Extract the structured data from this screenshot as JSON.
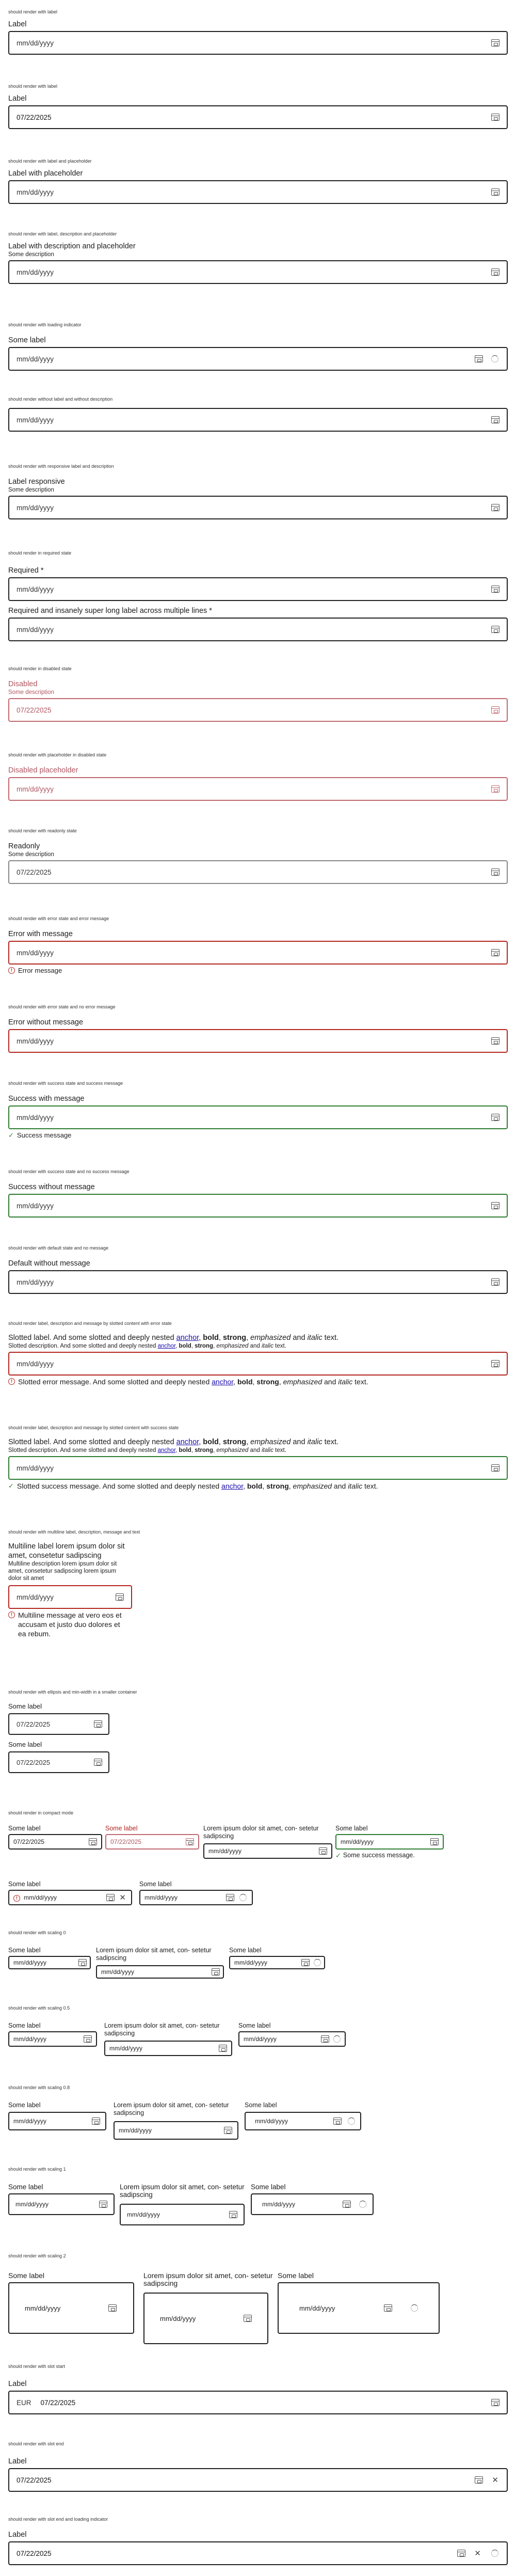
{
  "placeholder": "mm/dd/yyyy",
  "date": "07/22/2025",
  "s1": {
    "cap": "should render with label",
    "label": "Label"
  },
  "s2": {
    "cap": "should render with label",
    "label": "Label"
  },
  "s3": {
    "cap": "should render with label and placeholder",
    "label": "Label with placeholder"
  },
  "s4": {
    "cap": "should render with label, description and placeholder",
    "label": "Label with description and placeholder",
    "desc": "Some description"
  },
  "s5": {
    "cap": "should render with loading indicator",
    "label": "Some label"
  },
  "s6": {
    "cap": "should render without label and without description"
  },
  "s7": {
    "cap": "should render with responsive label and description",
    "label": "Label responsive",
    "desc": "Some description"
  },
  "s8": {
    "cap": "should render in required state",
    "label": "Required *",
    "label2": "Required and insanely super long label across multiple lines *"
  },
  "s9": {
    "cap": "should render in disabled state",
    "label": "Disabled",
    "desc": "Some description"
  },
  "s10": {
    "cap": "should render with placeholder in disabled state",
    "label": "Disabled placeholder"
  },
  "s11": {
    "cap": "should render with readonly state",
    "label": "Readonly",
    "desc": "Some description"
  },
  "s12": {
    "cap": "should render with error state and error message",
    "label": "Error with message",
    "msg": "Error message"
  },
  "s13": {
    "cap": "should render with error state and no error message",
    "label": "Error without message"
  },
  "s14": {
    "cap": "should render with success state and success message",
    "label": "Success with message",
    "msg": "Success message"
  },
  "s15": {
    "cap": "should render with success state and no success message",
    "label": "Success without message"
  },
  "s16": {
    "cap": "should render with default state and no message",
    "label": "Default without message"
  },
  "slot": {
    "cap_err": "should render label, description and message by slotted content with error state",
    "cap_ok": "should render label, description and message by slotted content with success state",
    "label_a": "Slotted label. And some slotted and deeply nested ",
    "desc_a": "Slotted description. And some slotted and deeply nested ",
    "err_a": "Slotted error message. And some slotted and deeply nested ",
    "ok_a": "Slotted success message. And some slotted and deeply nested ",
    "anchor": "anchor",
    "comma": ", ",
    "bold": "bold",
    "strong": "strong",
    "emph": "emphasized",
    "and": " and ",
    "italic": "italic",
    "text": " text."
  },
  "s19": {
    "cap": "should render with multiline label, description, message and text",
    "label": "Multiline label lorem ipsum dolor sit amet, consetetur sadipscing",
    "desc": "Multiline description lorem ipsum dolor sit amet, consetetur sadipscing lorem ipsum dolor sit amet",
    "msg": "Multiline message at vero eos et accusam et justo duo dolores et ea rebum."
  },
  "s20": {
    "cap": "should render with ellipsis and min-width in a smaller container",
    "label": "Some label"
  },
  "s21": {
    "cap": "should render in compact mode",
    "label": "Some label",
    "long": "Lorem ipsum dolor sit amet, con- setetur sadipscing",
    "success": "Some success message."
  },
  "scaling": {
    "c0": "should render with scaling 0",
    "c05": "should render with scaling 0.5",
    "c08": "should render with scaling 0.8",
    "c1": "should render with scaling 1",
    "c2": "should render with scaling 2",
    "label": "Some label",
    "long": "Lorem ipsum dolor sit amet, con- setetur sadipscing"
  },
  "s27": {
    "cap": "should render with slot start",
    "label": "Label",
    "prefix": "EUR"
  },
  "s28": {
    "cap": "should render with slot end",
    "label": "Label"
  },
  "s29": {
    "cap": "should render with slot end and loading indicator",
    "label": "Label"
  }
}
